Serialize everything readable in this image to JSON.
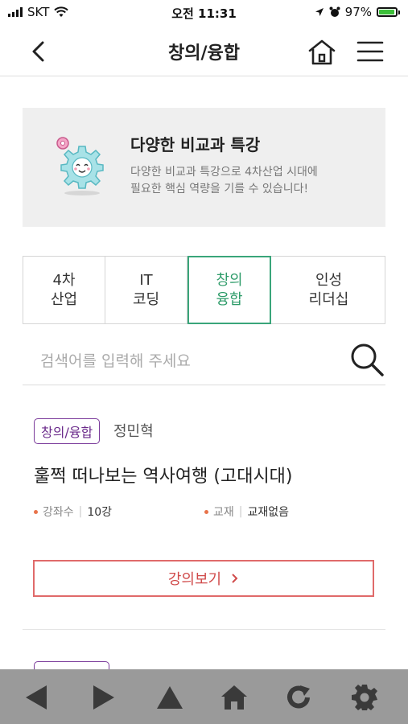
{
  "status_bar": {
    "carrier": "SKT",
    "time": "오전 11:31",
    "battery": "97%"
  },
  "header": {
    "title": "창의/융합"
  },
  "banner": {
    "title": "다양한 비교과 특강",
    "description": "다양한 비교과 특강으로 4차산업 시대에\n필요한 핵심 역량을 기를 수 있습니다!"
  },
  "tabs": [
    {
      "label": "4차\n산업",
      "active": false
    },
    {
      "label": "IT\n코딩",
      "active": false
    },
    {
      "label": "창의\n융합",
      "active": true
    },
    {
      "label": "인성\n리더십",
      "active": false
    }
  ],
  "search": {
    "placeholder": "검색어를 입력해 주세요"
  },
  "course": {
    "badge": "창의/융합",
    "instructor": "정민혁",
    "title": "훌쩍 떠나보는 역사여행 (고대시대)",
    "lectures_label": "강좌수",
    "lectures_value": "10강",
    "textbook_label": "교재",
    "textbook_value": "교재없음",
    "view_button": "강의보기"
  },
  "bottom_bar": {
    "buttons": [
      "back-icon",
      "forward-icon",
      "up-icon",
      "home-icon",
      "refresh-icon",
      "settings-icon"
    ]
  }
}
